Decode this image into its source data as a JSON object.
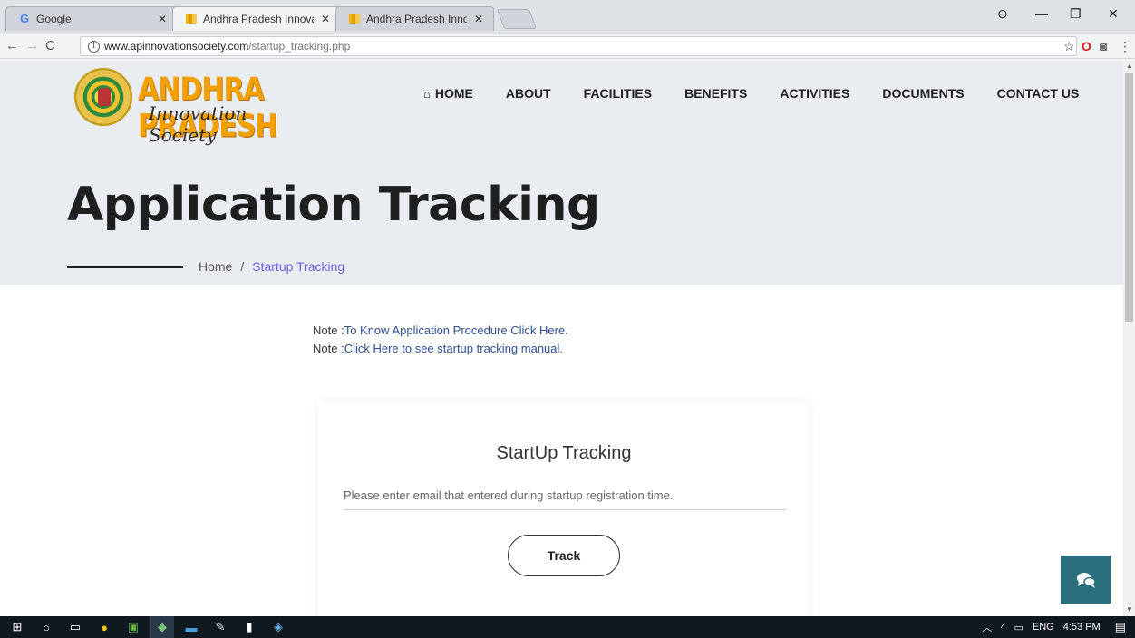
{
  "browser": {
    "tabs": [
      {
        "title": "Google",
        "favicon": "google-icon",
        "state": "inactive"
      },
      {
        "title": "Andhra Pradesh Innovati",
        "favicon": "ap-flag-icon",
        "state": "active"
      },
      {
        "title": "Andhra Pradesh Innovati",
        "favicon": "ap-flag-icon",
        "state": "inactive"
      }
    ],
    "url_domain": "www.apinnovationsociety.com",
    "url_path": "/startup_tracking.php"
  },
  "site": {
    "logo_title": "ANDHRA PRADESH",
    "logo_subtitle": "Innovation Society",
    "nav": [
      "HOME",
      "ABOUT",
      "FACILITIES",
      "BENEFITS",
      "ACTIVITIES",
      "DOCUMENTS",
      "CONTACT US"
    ]
  },
  "hero": {
    "title": "Application Tracking",
    "breadcrumb_home": "Home",
    "breadcrumb_sep": "/",
    "breadcrumb_current": "Startup Tracking"
  },
  "notes": [
    {
      "prefix": "Note :",
      "link": "To Know Application Procedure Click Here."
    },
    {
      "prefix": "Note :",
      "link": "Click Here to see startup tracking manual."
    }
  ],
  "form": {
    "title": "StartUp Tracking",
    "email_placeholder": "Please enter email that entered during startup registration time.",
    "email_value": "",
    "track_label": "Track"
  },
  "taskbar": {
    "language": "ENG",
    "time": "4:53 PM"
  },
  "colors": {
    "accent_link": "#6c63ff",
    "hero_bg": "#e9ecf0",
    "chat_bg": "#2b6f7e",
    "logo_orange": "#f2a100"
  }
}
